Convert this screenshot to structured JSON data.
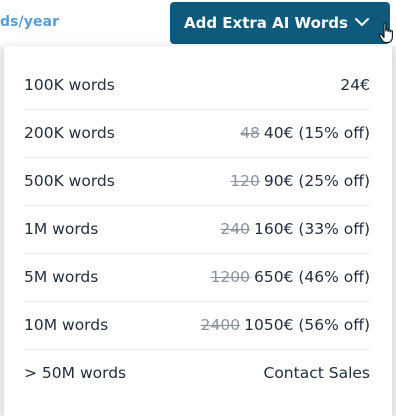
{
  "header": {
    "period_text": "ds/year",
    "add_button_label": "Add Extra AI Words",
    "chevron_icon": "chevron-down-icon",
    "cursor_icon": "hand-pointer-icon"
  },
  "colors": {
    "button_bg": "#0f5a7c",
    "period_text": "#5b9bd5",
    "row_text": "#1f2d3d",
    "strike_text": "#8a94a0"
  },
  "options": [
    {
      "words": "100K words",
      "old_price": "",
      "price": "24€"
    },
    {
      "words": "200K words",
      "old_price": "48",
      "price": "40€ (15% off)"
    },
    {
      "words": "500K words",
      "old_price": "120",
      "price": "90€ (25% off)"
    },
    {
      "words": "1M words",
      "old_price": "240",
      "price": "160€ (33% off)"
    },
    {
      "words": "5M words",
      "old_price": "1200",
      "price": "650€ (46% off)"
    },
    {
      "words": "10M words",
      "old_price": "2400",
      "price": "1050€ (56% off)"
    },
    {
      "words": "> 50M words",
      "old_price": "",
      "price": "Contact Sales"
    }
  ]
}
